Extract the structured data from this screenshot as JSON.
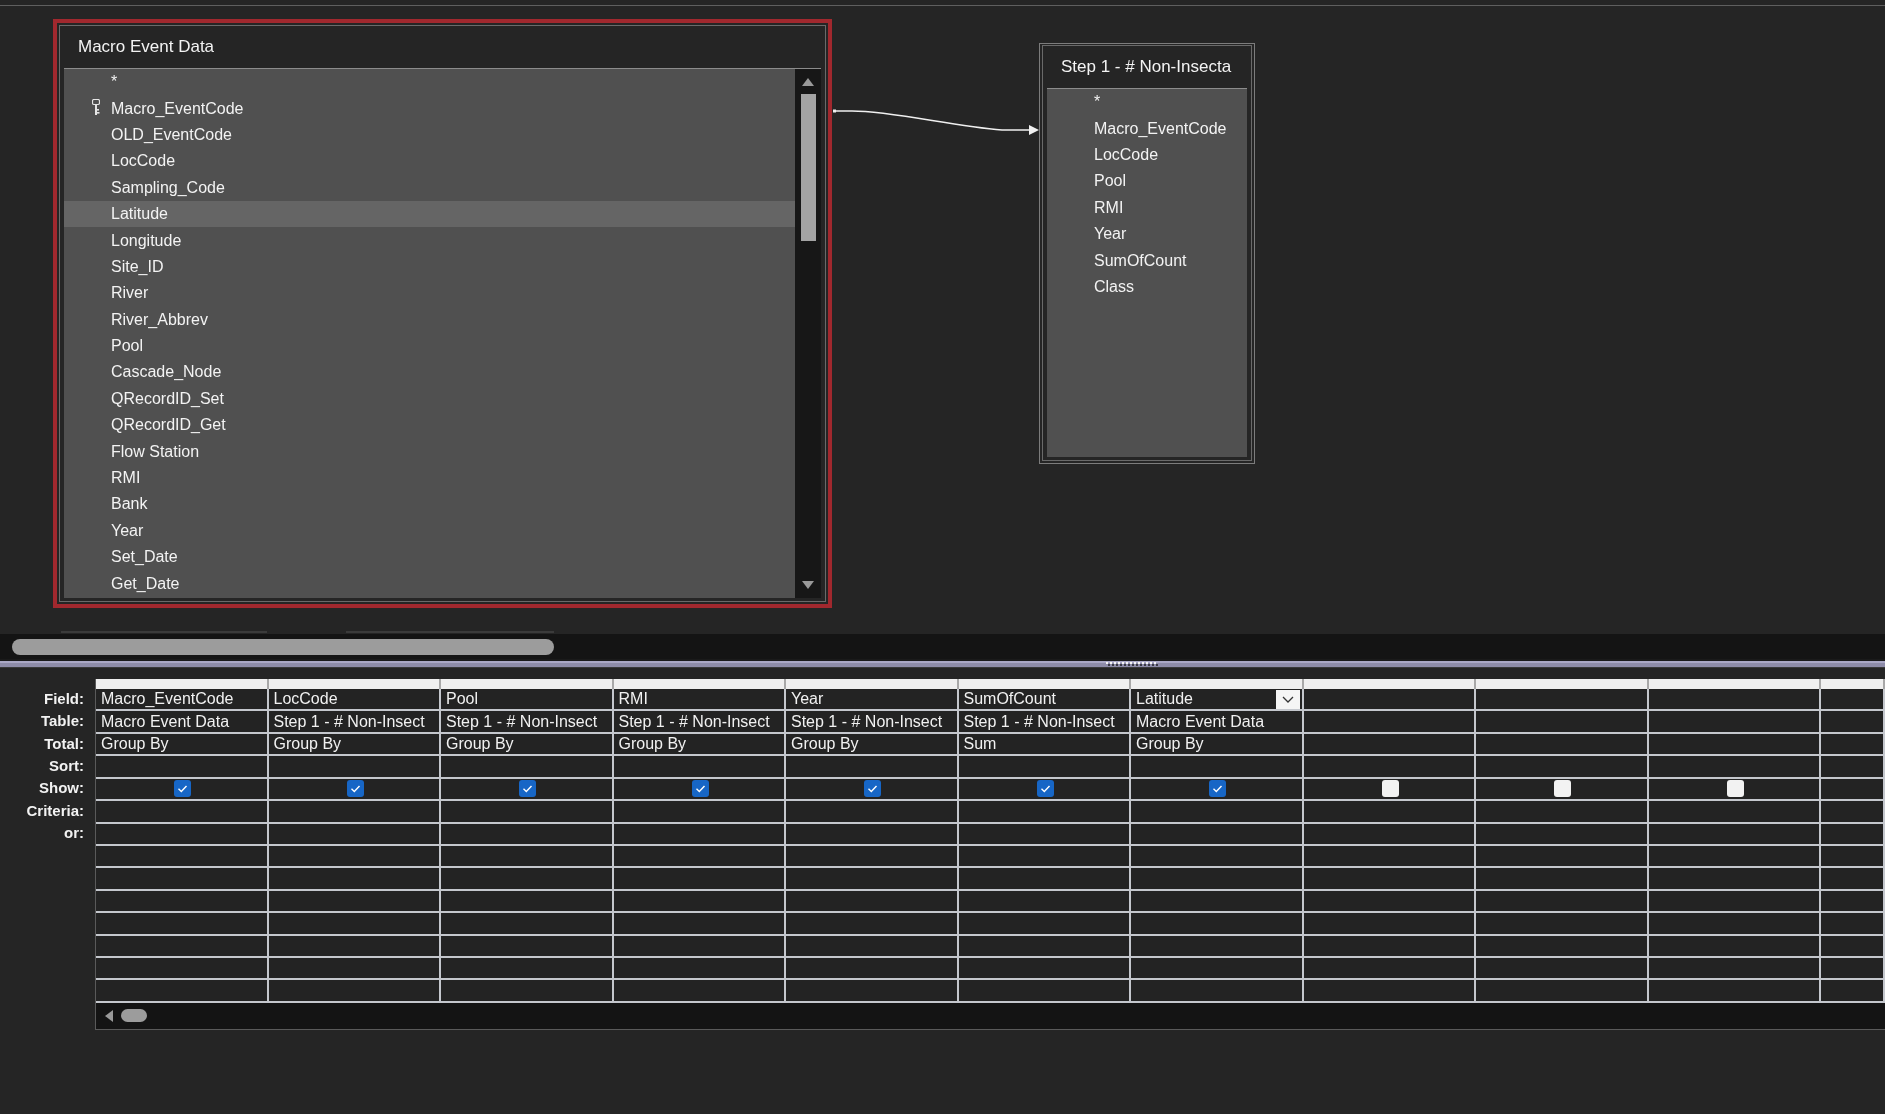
{
  "canvas": {
    "tables": [
      {
        "title": "Macro Event Data",
        "selected": true,
        "fields": [
          {
            "name": "*",
            "primary_key": false,
            "selected": false
          },
          {
            "name": "Macro_EventCode",
            "primary_key": true,
            "selected": false
          },
          {
            "name": "OLD_EventCode",
            "primary_key": false,
            "selected": false
          },
          {
            "name": "LocCode",
            "primary_key": false,
            "selected": false
          },
          {
            "name": "Sampling_Code",
            "primary_key": false,
            "selected": false
          },
          {
            "name": "Latitude",
            "primary_key": false,
            "selected": true
          },
          {
            "name": "Longitude",
            "primary_key": false,
            "selected": false
          },
          {
            "name": "Site_ID",
            "primary_key": false,
            "selected": false
          },
          {
            "name": "River",
            "primary_key": false,
            "selected": false
          },
          {
            "name": "River_Abbrev",
            "primary_key": false,
            "selected": false
          },
          {
            "name": "Pool",
            "primary_key": false,
            "selected": false
          },
          {
            "name": "Cascade_Node",
            "primary_key": false,
            "selected": false
          },
          {
            "name": "QRecordID_Set",
            "primary_key": false,
            "selected": false
          },
          {
            "name": "QRecordID_Get",
            "primary_key": false,
            "selected": false
          },
          {
            "name": "Flow Station",
            "primary_key": false,
            "selected": false
          },
          {
            "name": "RMI",
            "primary_key": false,
            "selected": false
          },
          {
            "name": "Bank",
            "primary_key": false,
            "selected": false
          },
          {
            "name": "Year",
            "primary_key": false,
            "selected": false
          },
          {
            "name": "Set_Date",
            "primary_key": false,
            "selected": false
          },
          {
            "name": "Get_Date",
            "primary_key": false,
            "selected": false
          }
        ]
      },
      {
        "title": "Step 1 - # Non-Insecta",
        "selected": false,
        "fields": [
          {
            "name": "*",
            "primary_key": false,
            "selected": false
          },
          {
            "name": "Macro_EventCode",
            "primary_key": false,
            "selected": false
          },
          {
            "name": "LocCode",
            "primary_key": false,
            "selected": false
          },
          {
            "name": "Pool",
            "primary_key": false,
            "selected": false
          },
          {
            "name": "RMI",
            "primary_key": false,
            "selected": false
          },
          {
            "name": "Year",
            "primary_key": false,
            "selected": false
          },
          {
            "name": "SumOfCount",
            "primary_key": false,
            "selected": false
          },
          {
            "name": "Class",
            "primary_key": false,
            "selected": false
          }
        ]
      }
    ]
  },
  "grid": {
    "row_labels": [
      "Field:",
      "Table:",
      "Total:",
      "Sort:",
      "Show:",
      "Criteria:",
      "or:"
    ],
    "columns": [
      {
        "field": "Macro_EventCode",
        "table": "Macro Event Data",
        "total": "Group By",
        "show": true,
        "active": false
      },
      {
        "field": "LocCode",
        "table": "Step 1 - # Non-Insect",
        "total": "Group By",
        "show": true,
        "active": false
      },
      {
        "field": "Pool",
        "table": "Step 1 - # Non-Insect",
        "total": "Group By",
        "show": true,
        "active": false
      },
      {
        "field": "RMI",
        "table": "Step 1 - # Non-Insect",
        "total": "Group By",
        "show": true,
        "active": false
      },
      {
        "field": "Year",
        "table": "Step 1 - # Non-Insect",
        "total": "Group By",
        "show": true,
        "active": false
      },
      {
        "field": "SumOfCount",
        "table": "Step 1 - # Non-Insect",
        "total": "Sum",
        "show": true,
        "active": false
      },
      {
        "field": "Latitude",
        "table": "Macro Event Data",
        "total": "Group By",
        "show": true,
        "active": true
      },
      {
        "show": false,
        "active": false
      },
      {
        "show": false,
        "active": false
      },
      {
        "show": false,
        "active": false
      }
    ]
  }
}
